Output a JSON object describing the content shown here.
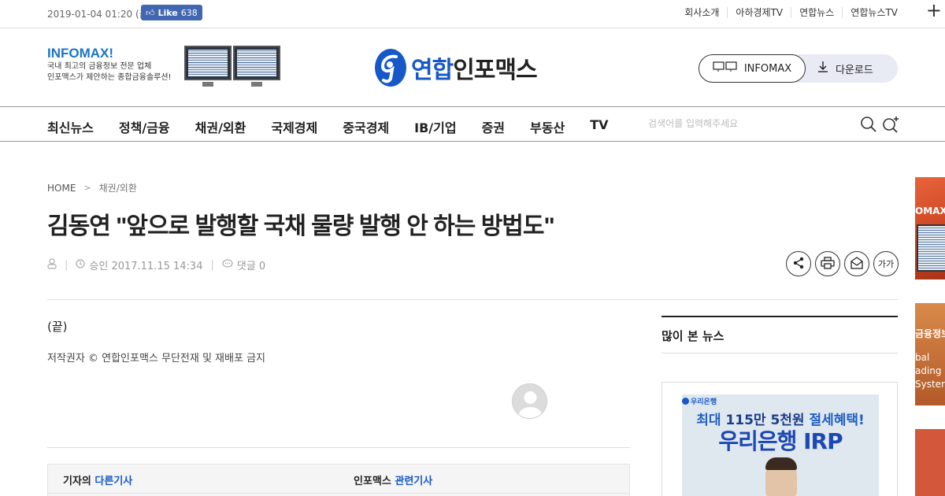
{
  "topbar": {
    "date": "2019-01-04 01:20 (금)",
    "fb_like_label": "Like",
    "fb_like_count": "638",
    "links": [
      "회사소개",
      "아하경제TV",
      "연합뉴스",
      "연합뉴스TV"
    ],
    "plus": "+"
  },
  "header": {
    "promo_brand": "INFOMAX!",
    "promo_line1": "국내 최고의 금융정보 전문 업체",
    "promo_line2": "인포맥스가 제안하는 종합금융솔루션!",
    "logo_text_blue": "연합",
    "logo_text": "인포맥스",
    "infomax_button": "INFOMAX",
    "download_button": "다운로드"
  },
  "nav": {
    "items": [
      "최신뉴스",
      "정책/금융",
      "채권/외환",
      "국제경제",
      "중국경제",
      "IB/기업",
      "증권",
      "부동산",
      "TV"
    ],
    "search_placeholder": "검색어를 입력해주세요"
  },
  "article": {
    "breadcrumb_home": "HOME",
    "breadcrumb_sep": ">",
    "breadcrumb_section": "채권/외환",
    "title": "김동연 \"앞으로 발행할 국채 물량 발행 안 하는 방법도\"",
    "meta_sep": "|",
    "approved": "승인 2017.11.15 14:34",
    "comments": "댓글 0",
    "font_size_tool": "가가",
    "body_end": "(끝)",
    "copyright": "저작권자 © 연합인포맥스 무단전재 및 재배포 금지",
    "related_left_prefix": "기자의 ",
    "related_left_highlight": "다른기사",
    "related_right_prefix": "인포맥스 ",
    "related_right_highlight": "관련기사"
  },
  "sidebar": {
    "popular_title": "많이 본 뉴스",
    "ad_bank": "우리은행",
    "ad_line1_prefix": "최대 ",
    "ad_line1_highlight": "115만 5천원",
    "ad_line1_suffix": " 절세혜택!",
    "ad_line2": "우리은행 IRP"
  },
  "edge_ads": {
    "ad1_text": "OMAX",
    "ad2_line1": "금융정보",
    "ad2_line2": "bal",
    "ad2_line3": "ading",
    "ad2_line4": "Syster"
  },
  "colors": {
    "brand_blue": "#1758c9",
    "facebook": "#4267b2",
    "infomax_blue": "#1a73c9"
  }
}
